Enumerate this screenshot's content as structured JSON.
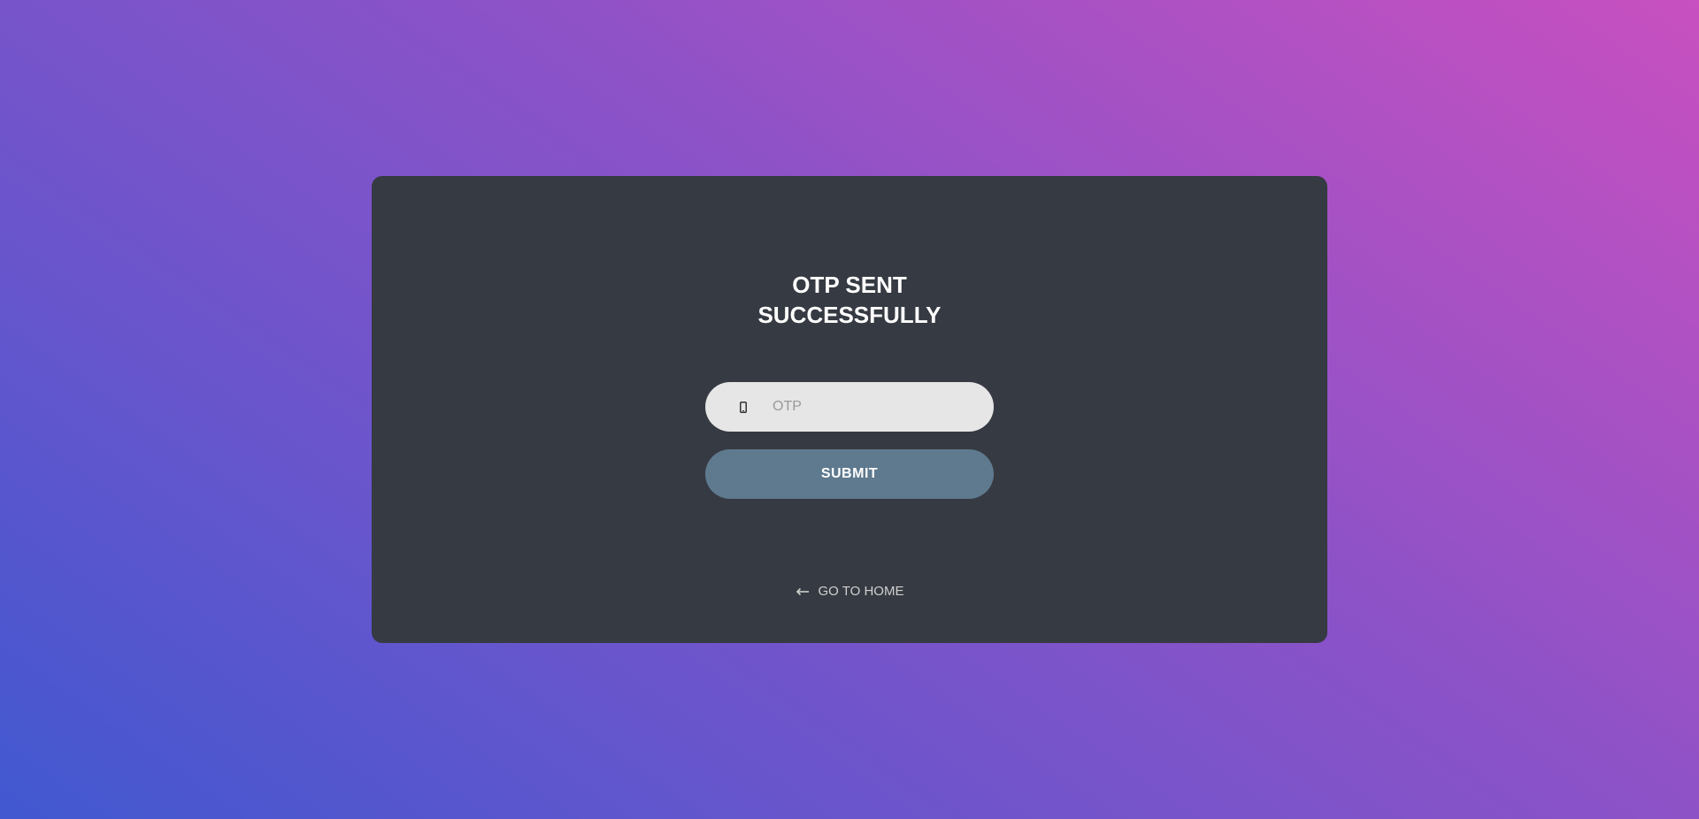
{
  "card": {
    "title_line1": "OTP SENT",
    "title_line2": "SUCCESSFULLY"
  },
  "otp": {
    "icon": "mobile-phone-icon",
    "placeholder": "OTP",
    "value": ""
  },
  "submit": {
    "label": "SUBMIT"
  },
  "home_link": {
    "icon": "arrow-left-icon",
    "label": "GO TO HOME"
  },
  "colors": {
    "card_bg": "#363a42",
    "input_bg": "#e6e6e6",
    "button_bg": "#5f7a8f",
    "gradient_start": "#4158d0",
    "gradient_end": "#c850c0"
  }
}
